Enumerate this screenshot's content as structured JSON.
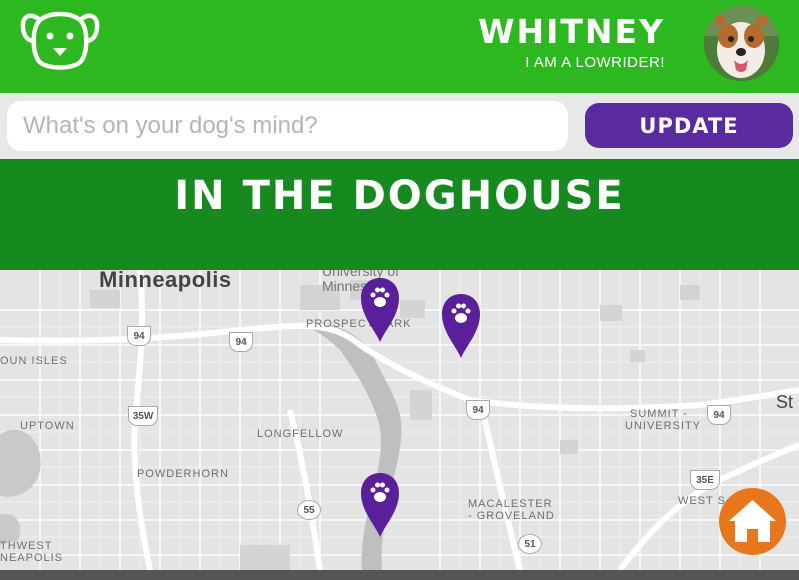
{
  "header": {
    "username": "WHITNEY",
    "tagline": "I AM A LOWRIDER!",
    "logo_icon": "dog-face-icon",
    "avatar_icon": "dog-avatar",
    "bg_color": "#2eb81f"
  },
  "post": {
    "placeholder": "What's on your dog's mind?",
    "update_label": "UPDATE",
    "button_color": "#5a2aa0"
  },
  "banner": {
    "title": "IN THE DOGHOUSE",
    "bg_color": "#168a1e"
  },
  "map": {
    "city": "Minneapolis",
    "university": "University of Minnesota",
    "neighborhoods": [
      "PROSPECT PARK",
      "LONGFELLOW",
      "POWDERHORN",
      "UPTOWN",
      "MACALESTER",
      "- GROVELAND",
      "SUMMIT -",
      "UNIVERSITY",
      "WEST S",
      "THWEST",
      "NEAPOLIS",
      "OUN ISLES"
    ],
    "st_label": "St",
    "highways": [
      "94",
      "94",
      "94",
      "35W",
      "55",
      "51",
      "94",
      "35E"
    ],
    "pins": [
      {
        "icon": "paw-icon",
        "color": "#5a1f9a"
      },
      {
        "icon": "paw-icon",
        "color": "#5a1f9a"
      },
      {
        "icon": "paw-icon",
        "color": "#5a1f9a"
      }
    ]
  },
  "home_button": {
    "icon": "home-icon",
    "color": "#e8761c"
  }
}
